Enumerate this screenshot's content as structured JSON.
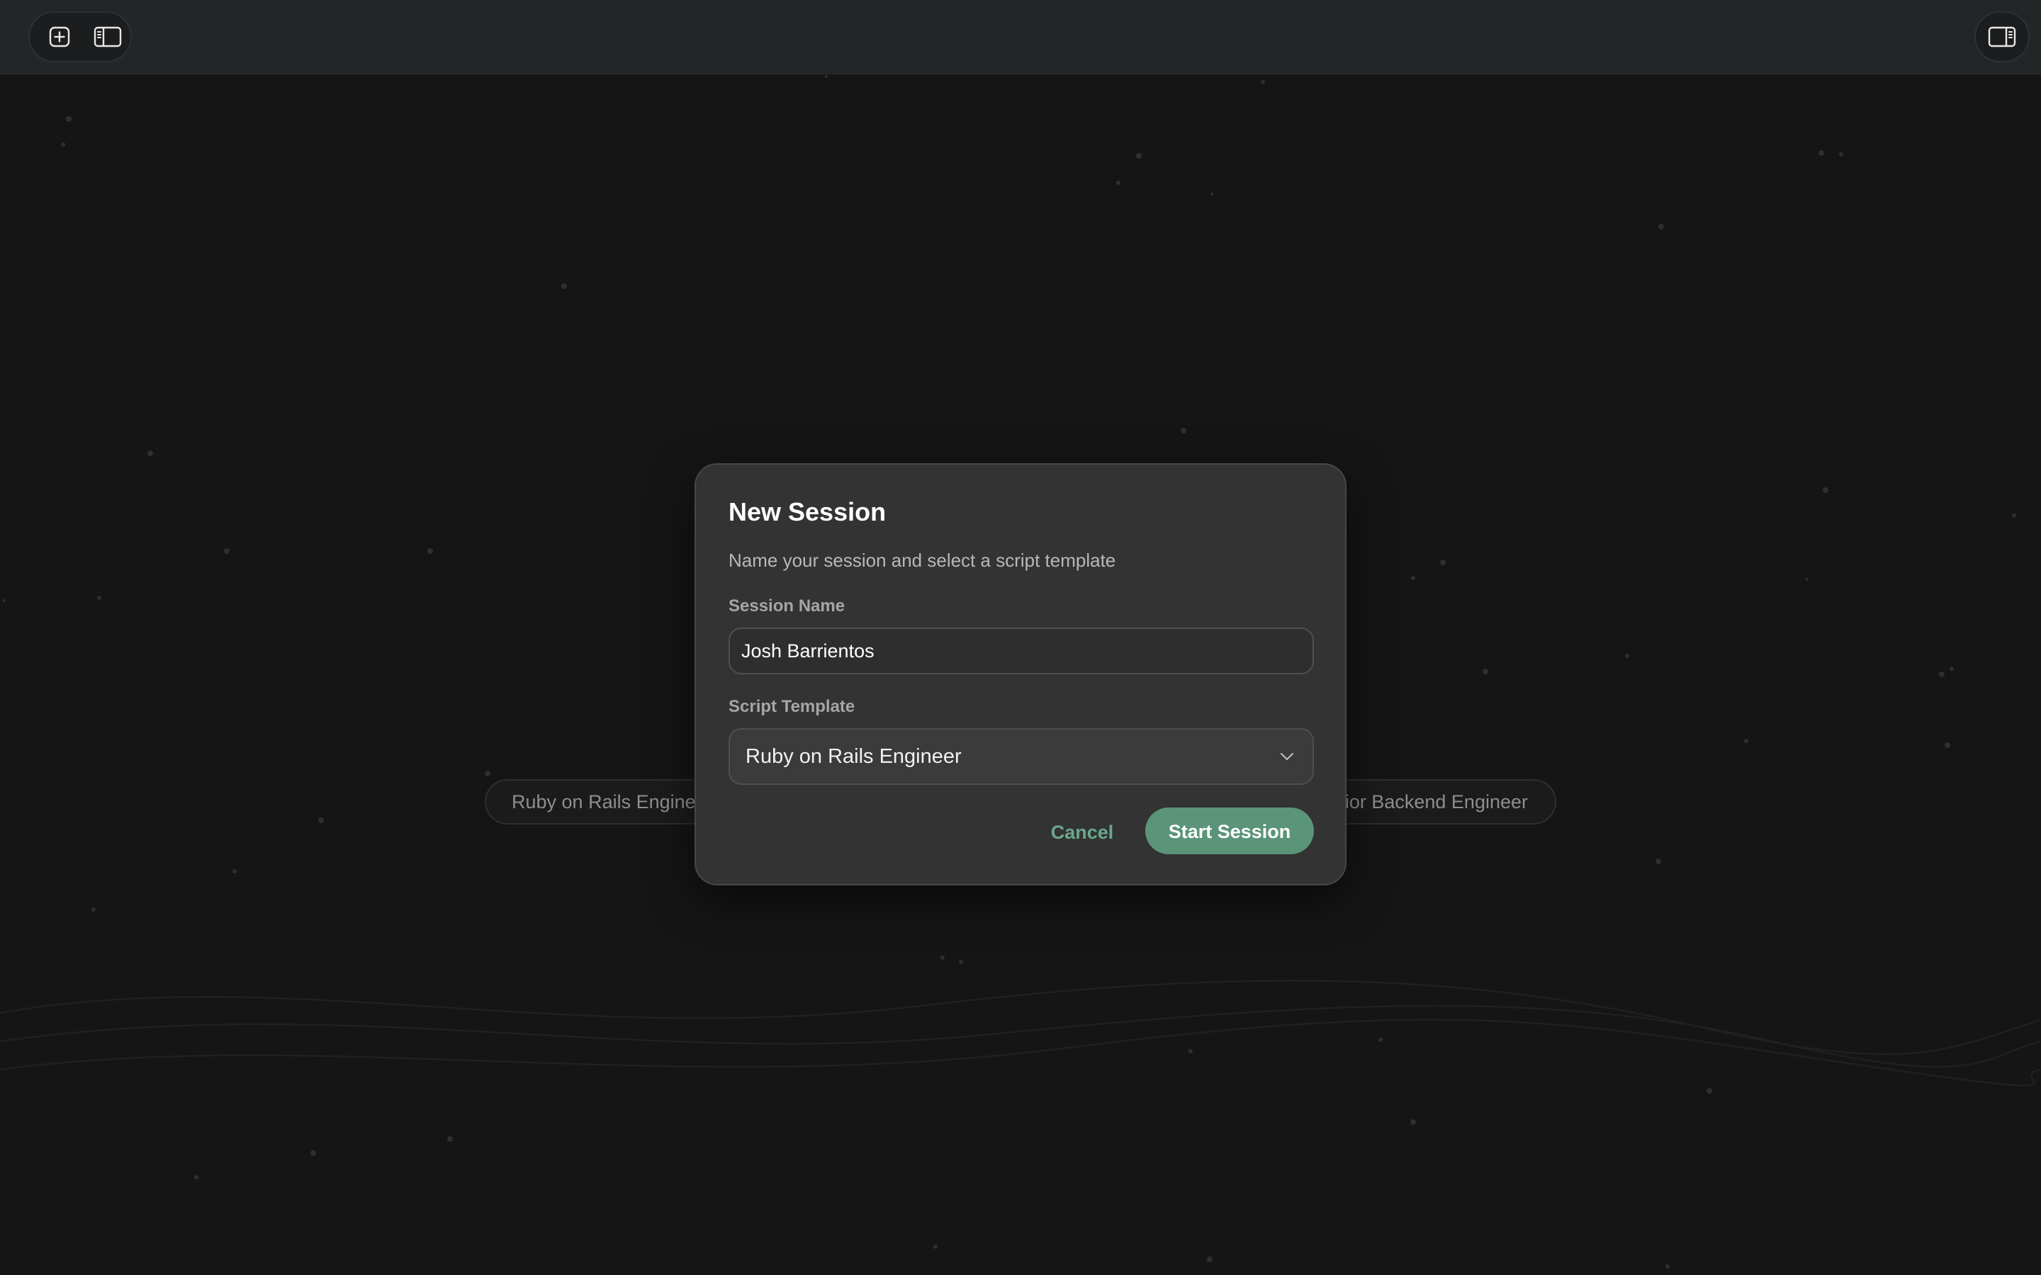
{
  "toolbar": {
    "new_icon": "plus-square-icon",
    "left_sidebar_icon": "sidebar-left-icon",
    "right_sidebar_icon": "sidebar-right-icon"
  },
  "background_chips": {
    "left_label": "Ruby on Rails Engineer",
    "right_label": "Senior Backend Engineer"
  },
  "dialog": {
    "title": "New Session",
    "subtitle": "Name your session and select a script template",
    "session_name_label": "Session Name",
    "session_name_value": "Josh Barrientos",
    "script_template_label": "Script Template",
    "script_template_value": "Ruby on Rails Engineer",
    "cancel_label": "Cancel",
    "start_label": "Start Session"
  },
  "colors": {
    "accent": "#5a9479",
    "accent_text": "#6aa88d",
    "background": "#141514",
    "dialog": "#333333"
  }
}
